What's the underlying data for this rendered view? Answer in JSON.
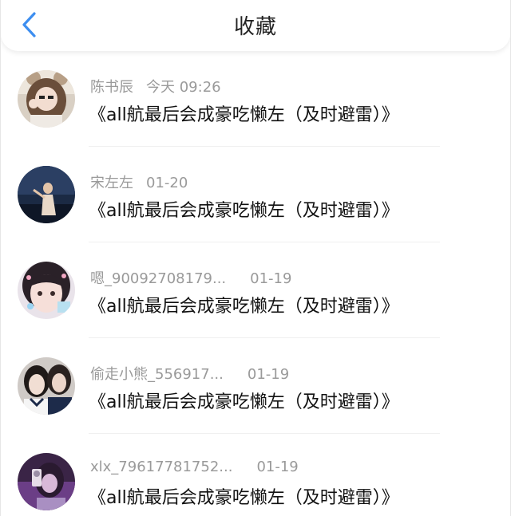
{
  "header": {
    "title": "收藏",
    "back_icon": "chevron-left-icon",
    "accent_color": "#3d8ef0"
  },
  "items": [
    {
      "name": "陈书辰",
      "time": "今天 09:26",
      "subject": "《all航最后会成豪吃懒左（及时避雷）》"
    },
    {
      "name": "宋左左",
      "time": "01-20",
      "subject": "《all航最后会成豪吃懒左（及时避雷）》"
    },
    {
      "name": "嗯_90092708179...",
      "time": "01-19",
      "subject": "《all航最后会成豪吃懒左（及时避雷）》"
    },
    {
      "name": "偷走小熊_556917...",
      "time": "01-19",
      "subject": "《all航最后会成豪吃懒左（及时避雷）》"
    },
    {
      "name": "xlx_79617781752...",
      "time": "01-19",
      "subject": "《all航最后会成豪吃懒左（及时避雷）》"
    }
  ]
}
